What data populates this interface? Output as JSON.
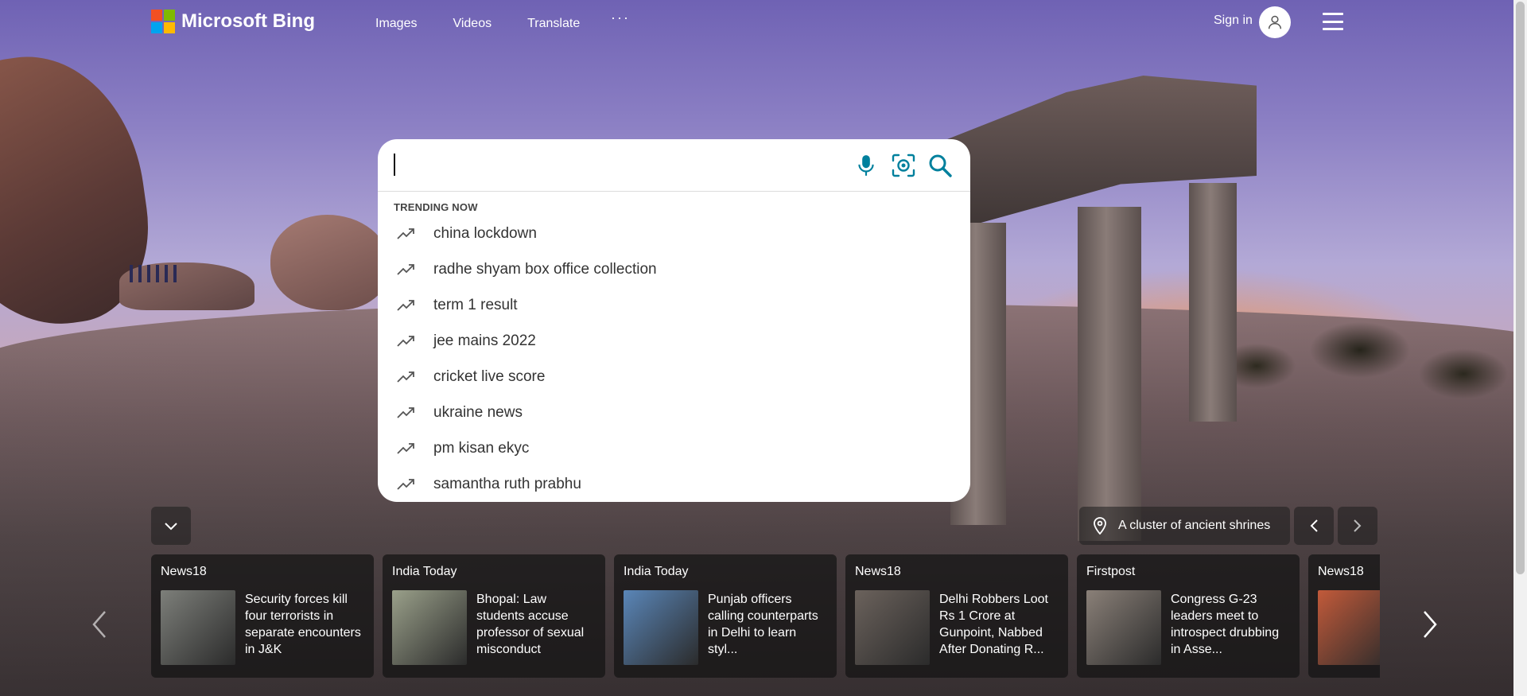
{
  "header": {
    "brand": "Microsoft Bing",
    "logo_colors": [
      "#f25022",
      "#7fba00",
      "#00a4ef",
      "#ffb900"
    ],
    "nav": [
      {
        "label": "Images"
      },
      {
        "label": "Videos"
      },
      {
        "label": "Translate"
      }
    ],
    "more_label": "···",
    "sign_in_label": "Sign in"
  },
  "search": {
    "value": "",
    "accent_color": "#00809d"
  },
  "trending": {
    "title": "TRENDING NOW",
    "items": [
      "china lockdown",
      "radhe shyam box office collection",
      "term 1 result",
      "jee mains 2022",
      "cricket live score",
      "ukraine news",
      "pm kisan ekyc",
      "samantha ruth prabhu"
    ]
  },
  "image_info": {
    "location_label": "A cluster of ancient shrines"
  },
  "news": [
    {
      "source": "News18",
      "title": "Security forces kill four terrorists in separate encounters in J&K",
      "thumb_color": "#7d7f7a"
    },
    {
      "source": "India Today",
      "title": "Bhopal: Law students accuse professor of sexual misconduct",
      "thumb_color": "#9aa08a"
    },
    {
      "source": "India Today",
      "title": "Punjab officers calling counterparts in Delhi to learn styl...",
      "thumb_color": "#5a86b8"
    },
    {
      "source": "News18",
      "title": "Delhi Robbers Loot Rs 1 Crore at Gunpoint, Nabbed After Donating R...",
      "thumb_color": "#6b625c"
    },
    {
      "source": "Firstpost",
      "title": "Congress G-23 leaders meet to introspect drubbing in Asse...",
      "thumb_color": "#8a8078"
    },
    {
      "source": "News18",
      "title": "",
      "thumb_color": "#c25a3a"
    }
  ]
}
